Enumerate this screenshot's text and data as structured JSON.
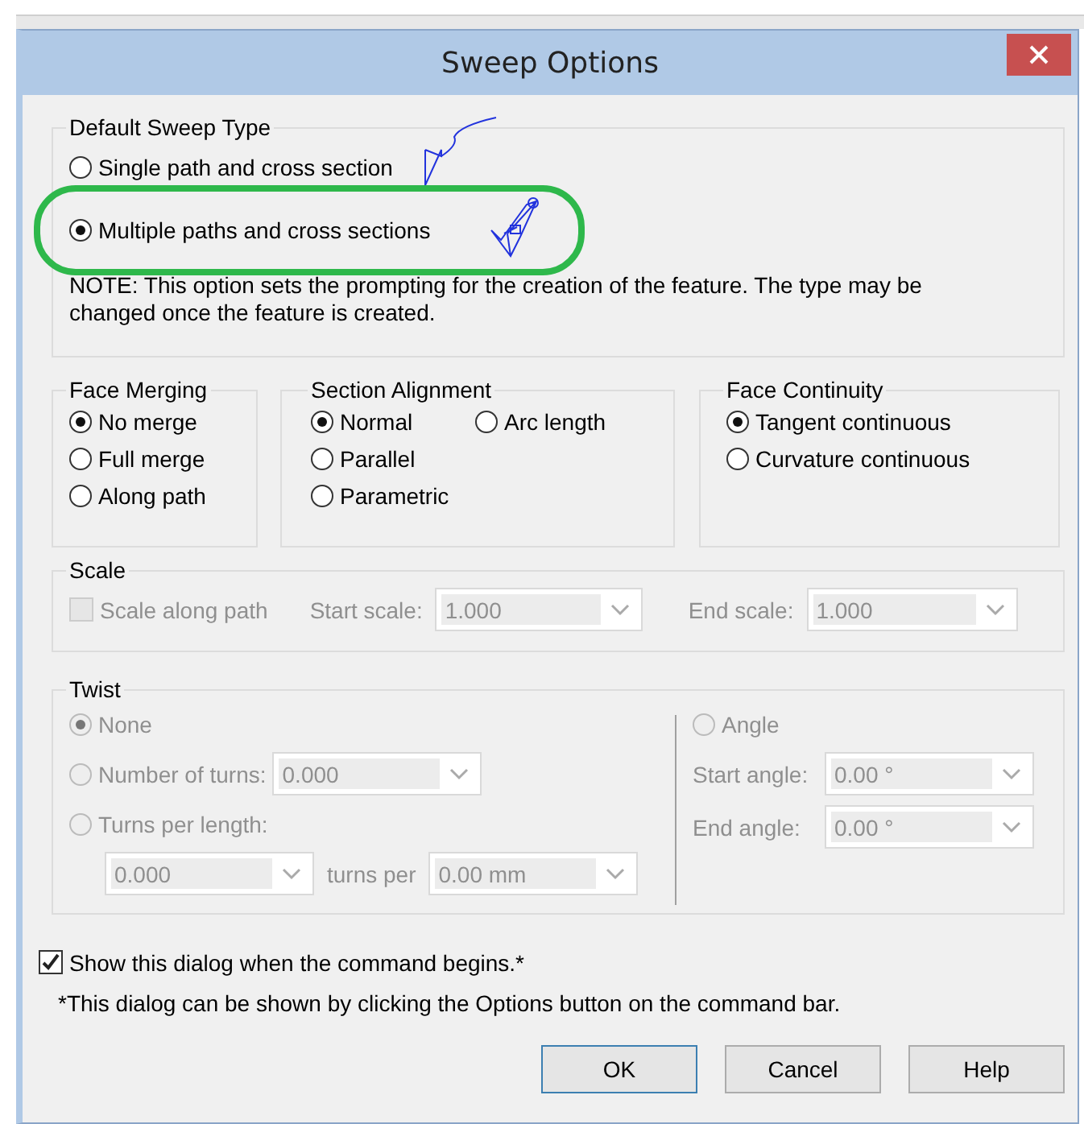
{
  "window": {
    "title": "Sweep Options"
  },
  "sweep_type": {
    "label": "Default Sweep Type",
    "options": [
      {
        "label": "Single path and cross section",
        "selected": false,
        "highlighted": false,
        "kind": "single"
      },
      {
        "label": "Multiple paths and cross sections",
        "selected": true,
        "highlighted": true,
        "kind": "multiple"
      }
    ],
    "note": "NOTE:  This option sets the prompting for the creation of the feature.  The type may be changed once the feature is created."
  },
  "face_merging": {
    "label": "Face Merging",
    "options": [
      {
        "label": "No merge",
        "selected": true
      },
      {
        "label": "Full merge",
        "selected": false
      },
      {
        "label": "Along path",
        "selected": false
      }
    ]
  },
  "section_alignment": {
    "label": "Section Alignment",
    "options": [
      {
        "label": "Normal",
        "selected": true
      },
      {
        "label": "Arc length",
        "selected": false
      },
      {
        "label": "Parallel",
        "selected": false
      },
      {
        "label": "Parametric",
        "selected": false
      }
    ]
  },
  "face_continuity": {
    "label": "Face Continuity",
    "options": [
      {
        "label": "Tangent continuous",
        "selected": true
      },
      {
        "label": "Curvature continuous",
        "selected": false
      }
    ]
  },
  "scale": {
    "label": "Scale",
    "disabled": true,
    "checkbox": {
      "label": "Scale along path",
      "checked": false
    },
    "start": {
      "label": "Start scale:",
      "value": "1.000"
    },
    "end": {
      "label": "End scale:",
      "value": "1.000"
    }
  },
  "twist": {
    "label": "Twist",
    "disabled": true,
    "none": {
      "label": "None",
      "selected": true
    },
    "number_of_turns": {
      "label": "Number of turns:",
      "selected": false,
      "value": "0.000"
    },
    "turns_per_length": {
      "label": "Turns per length:",
      "selected": false,
      "value": "0.000",
      "per_label": "turns per",
      "length": "0.00 mm"
    },
    "angle": {
      "label": "Angle",
      "selected": false,
      "start": {
        "label": "Start angle:",
        "value": "0.00 °"
      },
      "end": {
        "label": "End angle:",
        "value": "0.00 °"
      }
    }
  },
  "show_dialog": {
    "label": "Show this dialog when the command begins.*",
    "checked": true
  },
  "footnote": "*This dialog can be shown by clicking the Options button on the command bar.",
  "buttons": [
    {
      "label": "OK",
      "default": true
    },
    {
      "label": "Cancel",
      "default": false
    },
    {
      "label": "Help",
      "default": false
    }
  ]
}
